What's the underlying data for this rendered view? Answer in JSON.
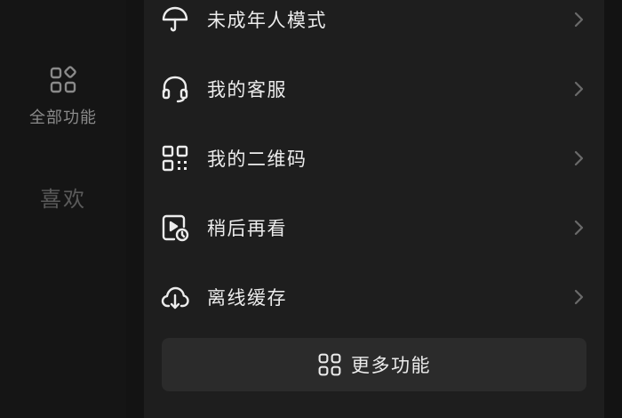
{
  "sidebar": {
    "items": [
      {
        "label": "全部功能",
        "icon": "grid-apps-icon"
      },
      {
        "label": "喜欢"
      }
    ]
  },
  "menu": {
    "items": [
      {
        "label": "未成年人模式",
        "icon": "umbrella-icon"
      },
      {
        "label": "我的客服",
        "icon": "headset-icon"
      },
      {
        "label": "我的二维码",
        "icon": "qr-code-icon"
      },
      {
        "label": "稍后再看",
        "icon": "watch-later-icon"
      },
      {
        "label": "离线缓存",
        "icon": "cloud-download-icon"
      }
    ],
    "more_button": {
      "label": "更多功能",
      "icon": "grid-apps-icon"
    }
  },
  "colors": {
    "background": "#131313",
    "sidebar": "#151515",
    "panel": "#1e1e1e",
    "button": "#2b2b2b",
    "text_primary": "#ececec",
    "text_secondary": "#8a8a8a",
    "text_dim": "#5a5a5a",
    "chevron": "#6a6a6a"
  }
}
